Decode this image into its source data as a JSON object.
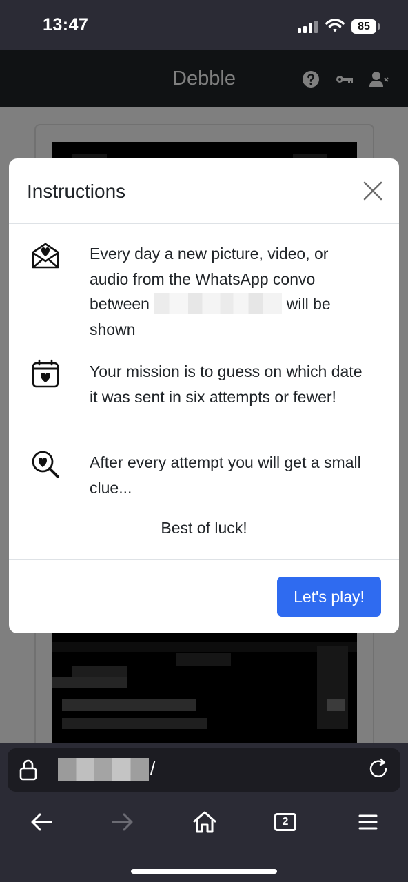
{
  "status_bar": {
    "time": "13:47",
    "battery": "85"
  },
  "app": {
    "title": "Debble",
    "icons": [
      "question-circle-icon",
      "key-icon",
      "person-remove-icon"
    ]
  },
  "modal": {
    "title": "Instructions",
    "items": [
      {
        "icon": "envelope-heart-icon",
        "text_before": "Every day a new picture, video, or audio from the WhatsApp convo between",
        "text_after": "will be shown"
      },
      {
        "icon": "calendar-heart-icon",
        "text": "Your mission is to guess on which date it was sent in six attempts or fewer!"
      },
      {
        "icon": "search-heart-icon",
        "text": "After every attempt you will get a small clue..."
      }
    ],
    "closing": "Best of luck!",
    "button_label": "Let's play!"
  },
  "browser": {
    "url_suffix": "/",
    "tab_count": "2"
  },
  "colors": {
    "primary": "#2f6bf0",
    "navbar": "#212529",
    "chrome": "#2b2b35"
  }
}
